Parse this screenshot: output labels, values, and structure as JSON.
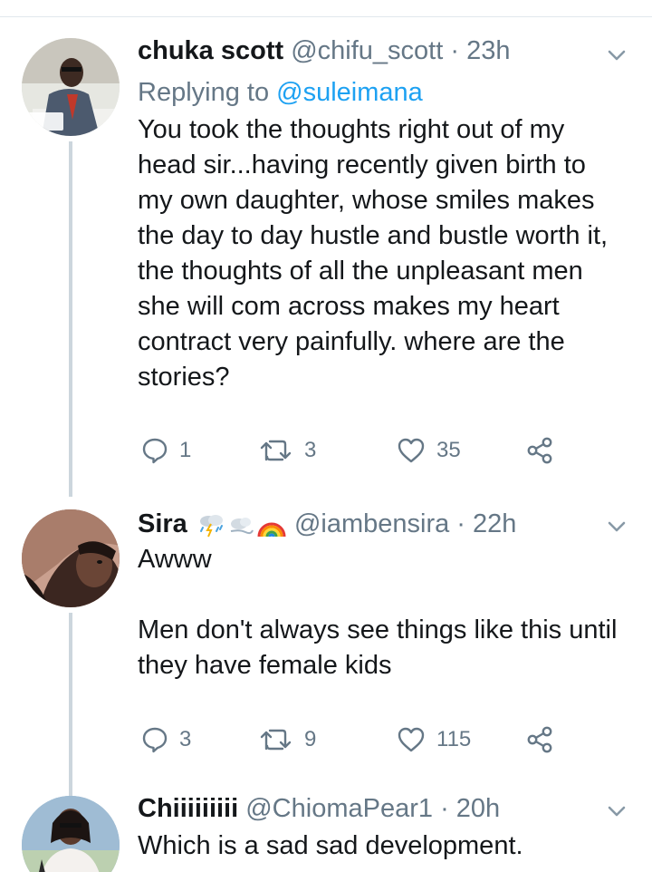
{
  "tweets": [
    {
      "name": "chuka scott",
      "handle": "@chifu_scott",
      "time": "23h",
      "replying_prefix": "Replying to ",
      "replying_to": "@suleimana",
      "text": "You took the thoughts right out of my head sir...having recently given birth to my own daughter, whose smiles makes the day to day hustle and bustle worth it, the thoughts of all the unpleasant men she will com across makes my heart contract very painfully. where are the stories?",
      "replies": "1",
      "retweets": "3",
      "likes": "35"
    },
    {
      "name": "Sira",
      "handle": "@iambensira",
      "time": "22h",
      "text": "Awww\n\nMen don't always see things like this until they have female kids",
      "replies": "3",
      "retweets": "9",
      "likes": "115"
    },
    {
      "name": "Chiiiiiiiii",
      "handle": "@ChiomaPear1",
      "time": "20h",
      "text": "Which is a sad sad development."
    }
  ],
  "separator": "·",
  "colors": {
    "text": "#14171a",
    "secondary": "#657786",
    "link": "#1da1f2",
    "thread_line": "#ccd6dd"
  },
  "icons": [
    "reply-icon",
    "retweet-icon",
    "like-icon",
    "share-icon",
    "chevron-down-icon"
  ]
}
